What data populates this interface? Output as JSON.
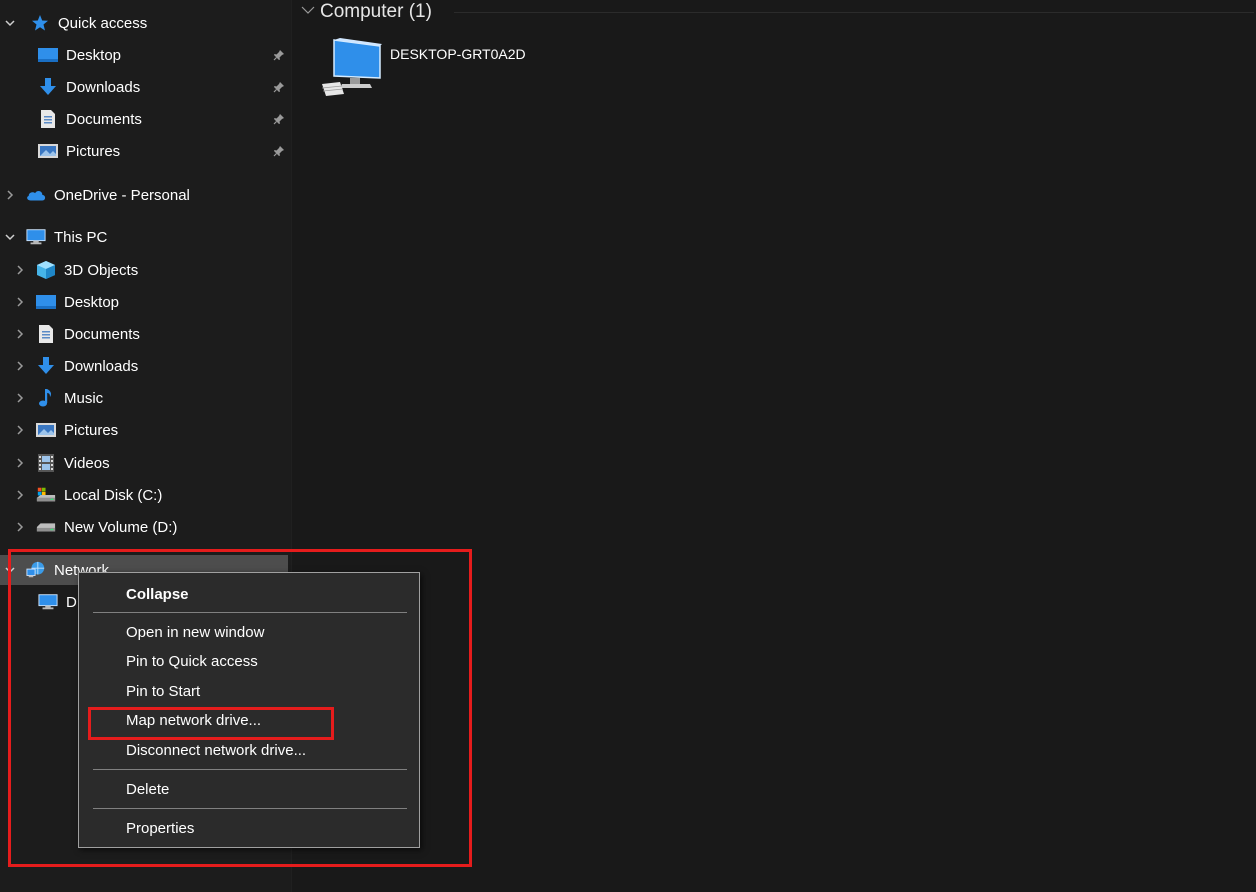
{
  "nav": {
    "quick_access": {
      "label": "Quick access",
      "items": [
        {
          "label": "Desktop",
          "icon": "desktop-folder-icon",
          "pinned": true
        },
        {
          "label": "Downloads",
          "icon": "downloads-folder-icon",
          "pinned": true
        },
        {
          "label": "Documents",
          "icon": "documents-folder-icon",
          "pinned": true
        },
        {
          "label": "Pictures",
          "icon": "pictures-folder-icon",
          "pinned": true
        }
      ]
    },
    "onedrive": {
      "label": "OneDrive - Personal",
      "icon": "onedrive-cloud-icon"
    },
    "this_pc": {
      "label": "This PC",
      "items": [
        {
          "label": "3D Objects",
          "icon": "3d-objects-folder-icon"
        },
        {
          "label": "Desktop",
          "icon": "desktop-folder-icon"
        },
        {
          "label": "Documents",
          "icon": "documents-folder-icon"
        },
        {
          "label": "Downloads",
          "icon": "downloads-folder-icon"
        },
        {
          "label": "Music",
          "icon": "music-folder-icon"
        },
        {
          "label": "Pictures",
          "icon": "pictures-folder-icon"
        },
        {
          "label": "Videos",
          "icon": "videos-folder-icon"
        },
        {
          "label": "Local Disk (C:)",
          "icon": "local-disk-icon"
        },
        {
          "label": "New Volume (D:)",
          "icon": "drive-icon"
        }
      ]
    },
    "network": {
      "label": "Network",
      "icon": "network-icon",
      "child_label": "D",
      "child_icon": "computer-icon"
    }
  },
  "content": {
    "group_title": "Computer (1)",
    "computer_name": "DESKTOP-GRT0A2D",
    "computer_icon": "computer-icon"
  },
  "context_menu": {
    "collapse": "Collapse",
    "open_new_window": "Open in new window",
    "pin_quick_access": "Pin to Quick access",
    "pin_start": "Pin to Start",
    "map_network_drive": "Map network drive...",
    "disconnect_network_drive": "Disconnect network drive...",
    "delete": "Delete",
    "properties": "Properties"
  },
  "colors": {
    "background": "#191919",
    "nav_background": "#1c1c1c",
    "menu_background": "#2b2b2b",
    "selection": "#4d4d4d",
    "accent_blue": "#2f8fea",
    "highlight_red": "#e51c1c"
  }
}
